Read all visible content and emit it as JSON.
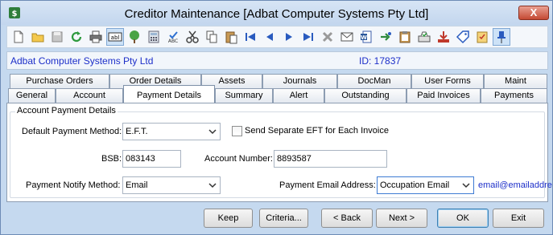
{
  "window": {
    "title": "Creditor Maintenance  [Adbat Computer Systems Pty Ltd]",
    "close_glyph": "X"
  },
  "toolbar": {
    "icons": [
      "new-document-icon",
      "open-folder-icon",
      "save-disk-icon",
      "refresh-icon",
      "print-icon",
      "field-label-icon",
      "tree-icon",
      "calculator-icon",
      "spell-check-icon",
      "cut-icon",
      "copy-icon",
      "paste-icon",
      "first-record-icon",
      "previous-record-icon",
      "next-record-icon",
      "last-record-icon",
      "delete-icon",
      "email-icon",
      "word-document-icon",
      "forward-icon",
      "clipboard-icon",
      "inbox-icon",
      "download-icon",
      "tag-icon",
      "task-list-icon",
      "pin-icon"
    ]
  },
  "company": {
    "name": "Adbat Computer Systems Pty Ltd",
    "id_text": "ID: 17837"
  },
  "tabs": {
    "row1": [
      "Purchase Orders",
      "Order Details",
      "Assets",
      "Journals",
      "DocMan",
      "User Forms",
      "Maint"
    ],
    "row2": [
      "General",
      "Account",
      "Payment Details",
      "Summary",
      "Alert",
      "Outstanding",
      "Paid Invoices",
      "Payments"
    ],
    "active": "Payment Details"
  },
  "payment": {
    "group_title": "Account Payment Details",
    "default_method_label": "Default Payment Method:",
    "default_method_value": "E.F.T.",
    "separate_eft_label": "Send Separate EFT for Each Invoice",
    "separate_eft_checked": false,
    "bsb_label": "BSB:",
    "bsb_value": "083143",
    "account_number_label": "Account Number:",
    "account_number_value": "8893587",
    "notify_method_label": "Payment Notify Method:",
    "notify_method_value": "Email",
    "email_address_label": "Payment Email Address:",
    "email_address_value": "Occupation Email",
    "email_link_text": "email@emailaddre"
  },
  "buttons": {
    "keep": "Keep",
    "criteria": "Criteria...",
    "back": "< Back",
    "next": "Next >",
    "ok": "OK",
    "exit": "Exit"
  }
}
